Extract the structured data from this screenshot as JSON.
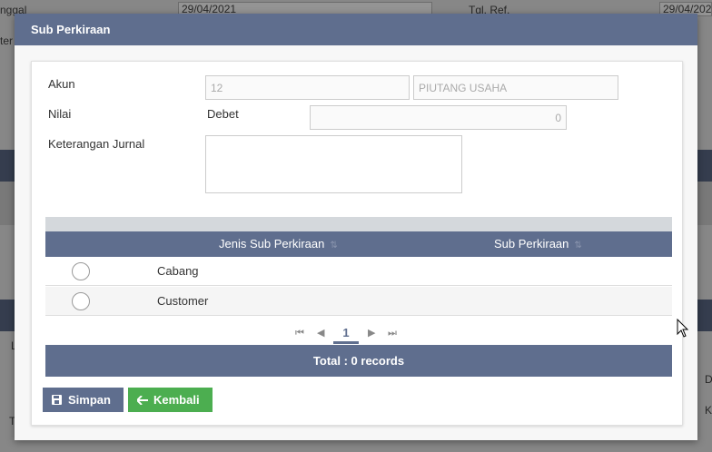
{
  "background": {
    "date_label": "nggal",
    "date_value": "29/04/2021",
    "ref_label": "Tgl. Ref.",
    "ref_value": "29/04/2021",
    "side_text_1": "ter",
    "side_text_2": "L",
    "side_text_3": "T",
    "side_text_4": "D",
    "side_text_5": "K"
  },
  "modal": {
    "title": "Sub Perkiraan",
    "form": {
      "akun_label": "Akun",
      "akun_code": "12",
      "akun_name": "PIUTANG USAHA",
      "nilai_label": "Nilai",
      "nilai_type": "Debet",
      "nilai_value": "0",
      "keterangan_label": "Keterangan Jurnal",
      "keterangan_value": ""
    },
    "table": {
      "columns": [
        "Jenis Sub Perkiraan",
        "Sub Perkiraan"
      ],
      "rows": [
        {
          "jenis": "Cabang",
          "sub": ""
        },
        {
          "jenis": "Customer",
          "sub": ""
        }
      ]
    },
    "pager": {
      "first": "⏮",
      "prev": "◀",
      "page": "1",
      "next": "▶",
      "last": "⏭"
    },
    "total_text": "Total : 0 records",
    "buttons": {
      "save_label": "Simpan",
      "back_label": "Kembali"
    }
  },
  "colors": {
    "header": "#5f6e8e",
    "save": "#5f6e8e",
    "back": "#4cae50"
  },
  "icons": {
    "save": "floppy-disk-icon",
    "back": "arrow-left-icon",
    "sort": "sort-icon"
  }
}
